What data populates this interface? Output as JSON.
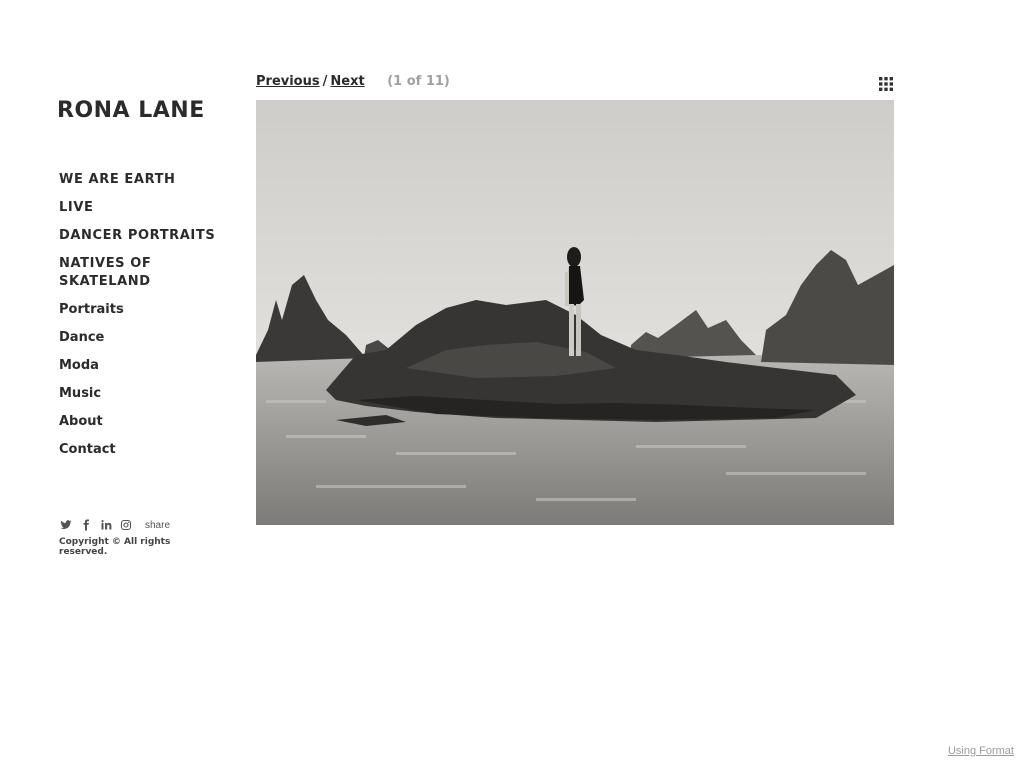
{
  "site": {
    "logo": "RONA LANE"
  },
  "nav": {
    "items": [
      {
        "label": "WE ARE EARTH"
      },
      {
        "label": "LIVE"
      },
      {
        "label": "DANCER PORTRAITS"
      },
      {
        "label": "NATIVES OF SKATELAND"
      },
      {
        "label": "Portraits"
      },
      {
        "label": "Dance"
      },
      {
        "label": "Moda"
      },
      {
        "label": "Music"
      },
      {
        "label": "About"
      },
      {
        "label": "Contact"
      }
    ]
  },
  "social": {
    "icons": [
      "twitter-icon",
      "facebook-icon",
      "linkedin-icon",
      "instagram-icon"
    ],
    "share_label": "share"
  },
  "footer": {
    "copyright": "Copyright © All rights reserved.",
    "format_link": "Using Format"
  },
  "gallery": {
    "previous_label": "Previous",
    "separator": "/",
    "next_label": "Next",
    "counter": "(1 of 11)",
    "grid_icon": "grid-view-icon",
    "image_description_tone": "black-and-white"
  },
  "colors": {
    "text": "#2b2b2b",
    "muted": "#a0a0a0",
    "background": "#ffffff"
  }
}
